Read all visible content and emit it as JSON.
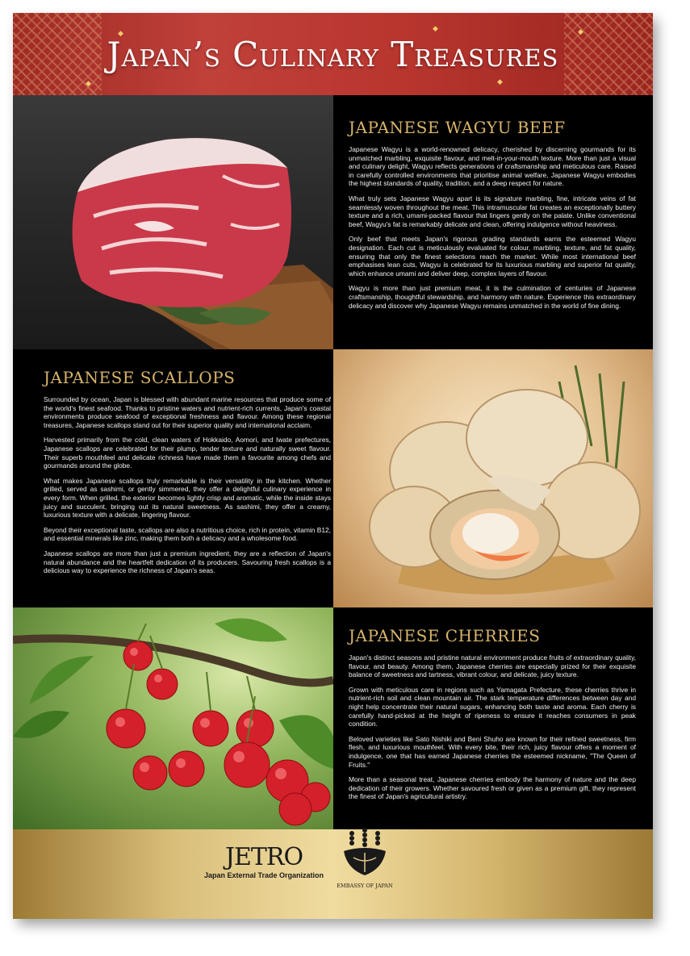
{
  "banner": {
    "title": "Japan’s Culinary Treasures"
  },
  "wagyu": {
    "heading": "JAPANESE WAGYU BEEF",
    "paragraphs": [
      "Japanese Wagyu is a world-renowned delicacy, cherished by discerning gourmands for its unmatched marbling, exquisite flavour, and melt-in-your-mouth texture. More than just a visual and culinary delight, Wagyu reflects generations of craftsmanship and meticulous care. Raised in carefully controlled environments that prioritise animal welfare, Japanese Wagyu embodies the highest standards of quality, tradition, and a deep respect for nature.",
      "What truly sets Japanese Wagyu apart is its signature marbling, fine, intricate veins of fat seamlessly woven throughout the meat. This intramuscular fat creates an exceptionally buttery texture and a rich, umami-packed flavour that lingers gently on the palate. Unlike conventional beef, Wagyu's fat is remarkably delicate and clean, offering indulgence without heaviness.",
      "Only beef that meets Japan's rigorous grading standards earns the esteemed Wagyu designation. Each cut is meticulously evaluated for colour, marbling, texture, and fat quality, ensuring that only the finest selections reach the market. While most international beef emphasises lean cuts, Wagyu is celebrated for its luxurious marbling and superior fat quality, which enhance umami and deliver deep, complex layers of flavour.",
      "Wagyu is more than just premium meat, it is the culmination of centuries of Japanese craftsmanship, thoughtful stewardship, and harmony with nature. Experience this extraordinary delicacy and discover why Japanese Wagyu remains unmatched in the world of fine dining."
    ]
  },
  "scallops": {
    "heading": "JAPANESE SCALLOPS",
    "paragraphs": [
      "Surrounded by ocean, Japan is blessed with abundant marine resources that produce some of the world's finest seafood. Thanks to pristine waters and nutrient-rich currents, Japan's coastal environments produce seafood of exceptional freshness and flavour. Among these regional treasures, Japanese scallops stand out for their superior quality and international acclaim.",
      "Harvested primarily from the cold, clean waters of Hokkaido, Aomori, and Iwate prefectures, Japanese scallops are celebrated for their plump, tender texture and naturally sweet flavour. Their superb mouthfeel and delicate richness have made them a favourite among chefs and gourmands around the globe.",
      "What makes Japanese scallops truly remarkable is their versatility in the kitchen. Whether grilled, served as sashimi, or gently simmered, they offer a delightful culinary experience in every form. When grilled, the exterior becomes lightly crisp and aromatic, while the inside stays juicy and succulent, bringing out its natural sweetness. As sashimi, they offer a creamy, luxurious texture with a delicate, lingering flavour.",
      "Beyond their exceptional taste, scallops are also a nutritious choice, rich in protein, vitamin B12, and essential minerals like zinc, making them both a delicacy and a wholesome food.",
      "Japanese scallops are more than just a premium ingredient, they are a reflection of Japan's natural abundance and the heartfelt dedication of its producers. Savouring fresh scallops is a delicious way to experience the richness of Japan's seas."
    ]
  },
  "cherries": {
    "heading": "JAPANESE CHERRIES",
    "paragraphs": [
      "Japan's distinct seasons and pristine natural environment produce fruits of extraordinary quality, flavour, and beauty. Among them, Japanese cherries are especially prized for their exquisite balance of sweetness and tartness, vibrant colour, and delicate, juicy texture.",
      "Grown with meticulous care in regions such as Yamagata Prefecture, these cherries thrive in nutrient-rich soil and clean mountain air. The stark temperature differences between day and night help concentrate their natural sugars, enhancing both taste and aroma. Each cherry is carefully hand-picked at the height of ripeness to ensure it reaches consumers in peak condition.",
      "Beloved varieties like Sato Nishiki and Beni Shuho are known for their refined sweetness, firm flesh, and luxurious mouthfeel. With every bite, their rich, juicy flavour offers a moment of indulgence, one that has earned Japanese cherries the esteemed nickname, \"The Queen of Fruits.\"",
      "More than a seasonal treat, Japanese cherries embody the harmony of nature and the deep dedication of their growers. Whether savoured fresh or given as a premium gift, they represent the finest of Japan's agricultural artistry."
    ]
  },
  "footer": {
    "jetro_logo": "JETRO",
    "jetro_name": "Japan External Trade Organization",
    "embassy_name": "EMBASSY OF JAPAN"
  },
  "colors": {
    "banner_red": "#b9362f",
    "heading_gold": "#d8b46a",
    "footer_gold": "#e3c989",
    "panel_black": "#000000"
  }
}
